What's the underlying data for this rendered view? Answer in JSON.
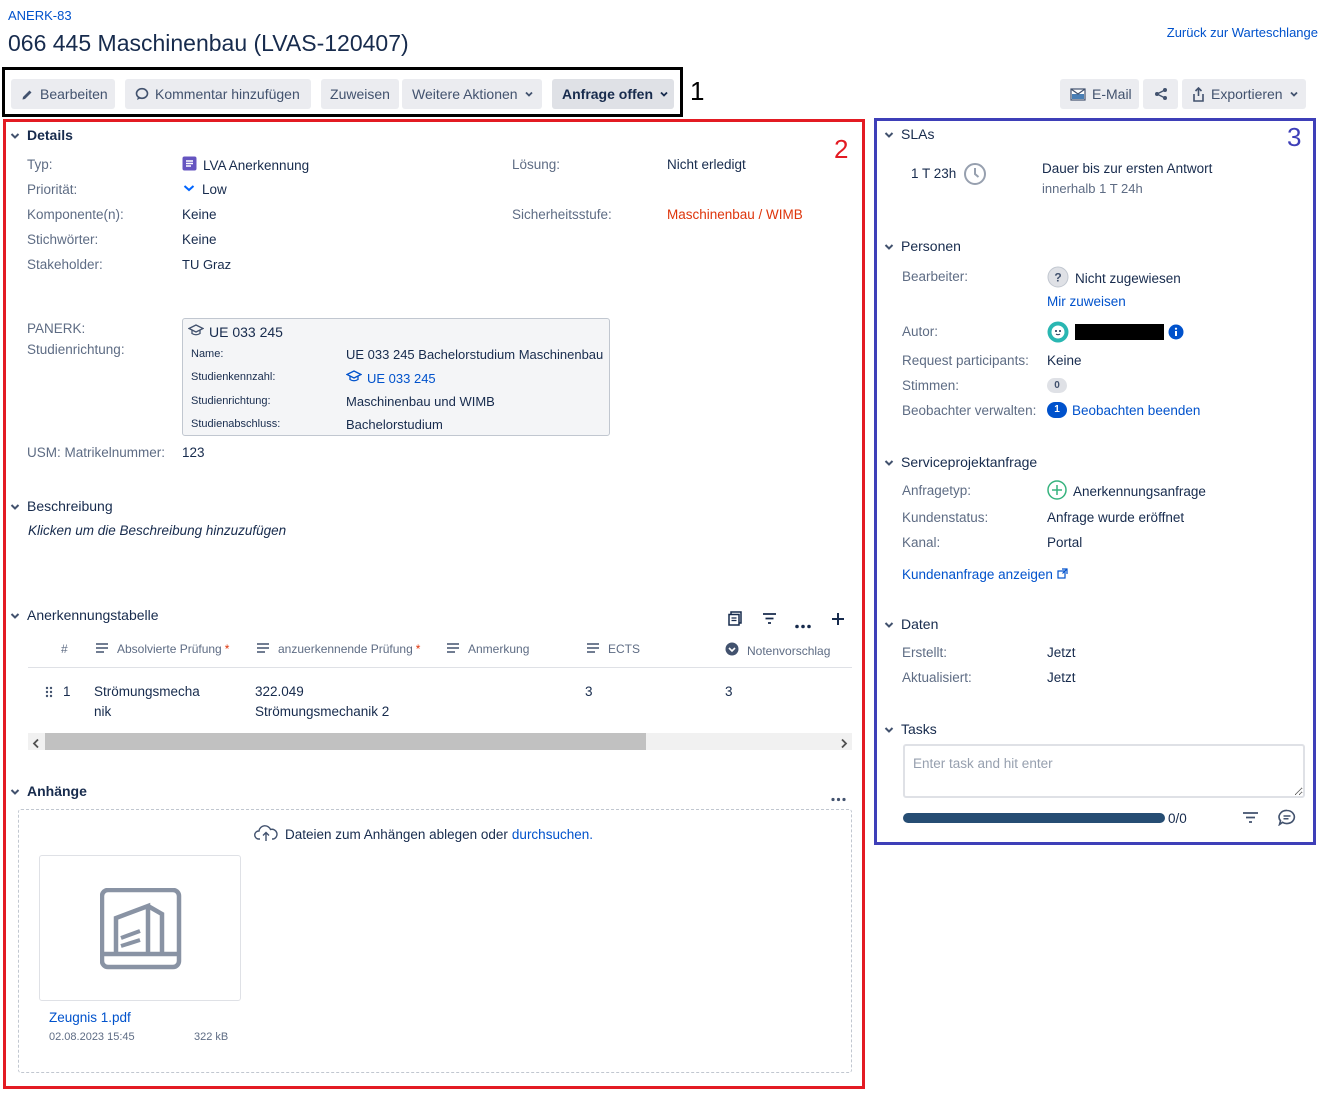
{
  "header": {
    "issue_key": "ANERK-83",
    "title": "066 445 Maschinenbau (LVAS-120407)",
    "back_link": "Zurück zur Warteschlange"
  },
  "toolbar": {
    "edit": "Bearbeiten",
    "comment": "Kommentar hinzufügen",
    "assign": "Zuweisen",
    "more_actions": "Weitere Aktionen",
    "status": "Anfrage offen",
    "email": "E-Mail",
    "export": "Exportieren"
  },
  "annotations": {
    "box1": "1",
    "box2": "2",
    "box3": "3"
  },
  "details": {
    "heading": "Details",
    "type_label": "Typ:",
    "type_value": "LVA Anerkennung",
    "priority_label": "Priorität:",
    "priority_value": "Low",
    "components_label": "Komponente(n):",
    "components_value": "Keine",
    "keywords_label": "Stichwörter:",
    "keywords_value": "Keine",
    "stakeholder_label": "Stakeholder:",
    "stakeholder_value": "TU Graz",
    "resolution_label": "Lösung:",
    "resolution_value": "Nicht erledigt",
    "security_label": "Sicherheitsstufe:",
    "security_value": "Maschinenbau / WIMB",
    "panerk_label": "PANERK:",
    "studienrichtung_label": "Studienrichtung:",
    "matrikel_label": "USM: Matrikelnummer:",
    "matrikel_value": "123",
    "card": {
      "title": "UE 033 245",
      "name_label": "Name:",
      "name_value": "UE 033 245 Bachelorstudium Maschinenbau",
      "kennzahl_label": "Studienkennzahl:",
      "kennzahl_value": "UE 033 245",
      "richtung_label": "Studienrichtung:",
      "richtung_value": "Maschinenbau und WIMB",
      "abschluss_label": "Studienabschluss:",
      "abschluss_value": "Bachelorstudium"
    }
  },
  "description": {
    "heading": "Beschreibung",
    "placeholder": "Klicken um die Beschreibung hinzuzufügen"
  },
  "table": {
    "heading": "Anerkennungstabelle",
    "columns": [
      "#",
      "Absolvierte Prüfung",
      "anzuerkennende Prüfung",
      "Anmerkung",
      "ECTS",
      "Notenvorschlag"
    ],
    "required_mark": "*",
    "rows": [
      {
        "num": "1",
        "absolviert_line1": "Strömungsmecha",
        "absolviert_line2": "nik",
        "anzuerkennend_line1": "322.049",
        "anzuerkennend_line2": "Strömungsmechanik 2",
        "anmerkung": "",
        "ects": "3",
        "note": "3"
      }
    ]
  },
  "attachments": {
    "heading": "Anhänge",
    "drop_text": "Dateien zum Anhängen ablegen oder",
    "browse_link": "durchsuchen.",
    "file": {
      "name": "Zeugnis 1.pdf",
      "date": "02.08.2023 15:45",
      "size": "322 kB"
    }
  },
  "sla": {
    "heading": "SLAs",
    "time": "1 T 23h",
    "title": "Dauer bis zur ersten Antwort",
    "within": "innerhalb 1 T 24h"
  },
  "people": {
    "heading": "Personen",
    "assignee_label": "Bearbeiter:",
    "assignee_value": "Nicht zugewiesen",
    "assign_me": "Mir zuweisen",
    "author_label": "Autor:",
    "participants_label": "Request participants:",
    "participants_value": "Keine",
    "votes_label": "Stimmen:",
    "votes_value": "0",
    "watchers_label": "Beobachter verwalten:",
    "watchers_count": "1",
    "watchers_action": "Beobachten beenden"
  },
  "service": {
    "heading": "Serviceprojektanfrage",
    "type_label": "Anfragetyp:",
    "type_value": "Anerkennungsanfrage",
    "status_label": "Kundenstatus:",
    "status_value": "Anfrage wurde eröffnet",
    "channel_label": "Kanal:",
    "channel_value": "Portal",
    "view_link": "Kundenanfrage anzeigen"
  },
  "dates": {
    "heading": "Daten",
    "created_label": "Erstellt:",
    "created_value": "Jetzt",
    "updated_label": "Aktualisiert:",
    "updated_value": "Jetzt"
  },
  "tasks": {
    "heading": "Tasks",
    "placeholder": "Enter task and hit enter",
    "progress_text": "0/0"
  },
  "colors": {
    "accent": "#0052cc",
    "red": "#de350b",
    "box1": "#000000",
    "box2": "#e31b23",
    "box3": "#3e3fb8"
  }
}
